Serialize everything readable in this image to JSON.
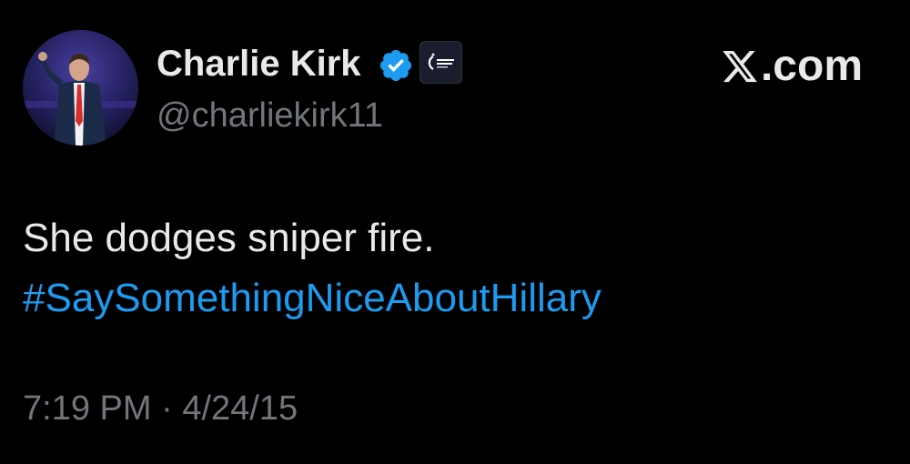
{
  "author": {
    "name": "Charlie Kirk",
    "handle": "@charliekirk11",
    "affiliate_badge_text": "TURNING POINT USA"
  },
  "brand": {
    "domain": ".com"
  },
  "tweet": {
    "text": "She dodges sniper fire.",
    "hashtag": "#SaySomethingNiceAboutHillary",
    "time": "7:19 PM",
    "separator": "·",
    "date": "4/24/15"
  },
  "icons": {
    "verified": "verified-badge-icon",
    "x_logo": "x-logo-icon",
    "affiliate": "turning-point-usa-logo"
  },
  "colors": {
    "background": "#000000",
    "text_primary": "#e7e9ea",
    "text_secondary": "#71767b",
    "link": "#1d9bf0",
    "verified": "#1d9bf0"
  }
}
